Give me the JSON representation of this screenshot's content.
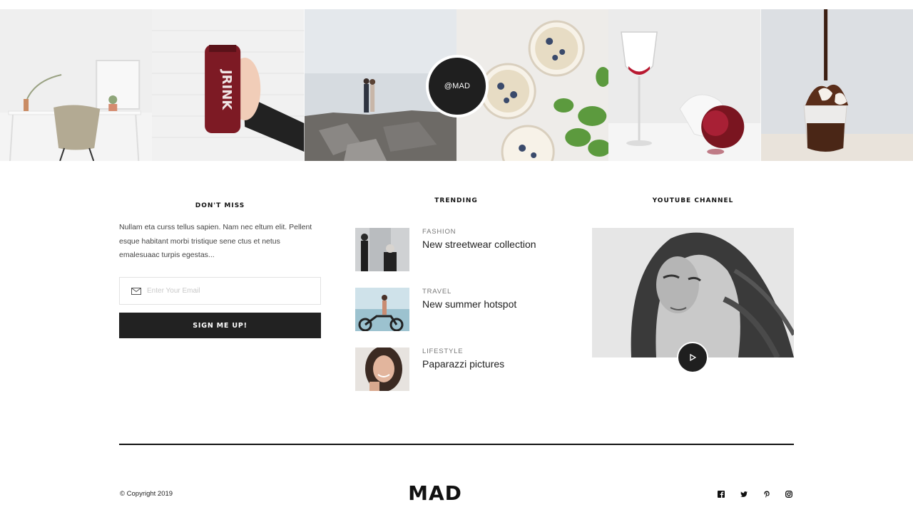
{
  "instagram": {
    "handle": "@MAD",
    "photos": [
      "desk-chair-photo",
      "juice-bottle-photo",
      "couple-rocks-photo",
      "chia-bowls-photo",
      "wine-pomegranate-photo",
      "chocolate-dessert-photo"
    ]
  },
  "dont_miss": {
    "title": "DON'T MISS",
    "text": "Nullam eta curss tellus sapien. Nam nec eltum elit. Pellent esque habitant morbi tristique sene ctus et netus emalesuaac turpis egestas...",
    "email_placeholder": "Enter Your Email",
    "button_label": "SIGN ME UP!"
  },
  "trending": {
    "title": "TRENDING",
    "items": [
      {
        "category": "FASHION",
        "title": "New streetwear collection"
      },
      {
        "category": "TRAVEL",
        "title": "New summer hotspot"
      },
      {
        "category": "LIFESTYLE",
        "title": "Paparazzi pictures"
      }
    ]
  },
  "youtube": {
    "title": "YOUTUBE CHANNEL"
  },
  "footer": {
    "copyright": "© Copyright 2019",
    "logo": "MAD",
    "social": [
      "facebook-icon",
      "twitter-icon",
      "pinterest-icon",
      "instagram-icon"
    ]
  },
  "colors": {
    "dark": "#222222",
    "border": "#e2e2e2",
    "muted": "#777777"
  }
}
